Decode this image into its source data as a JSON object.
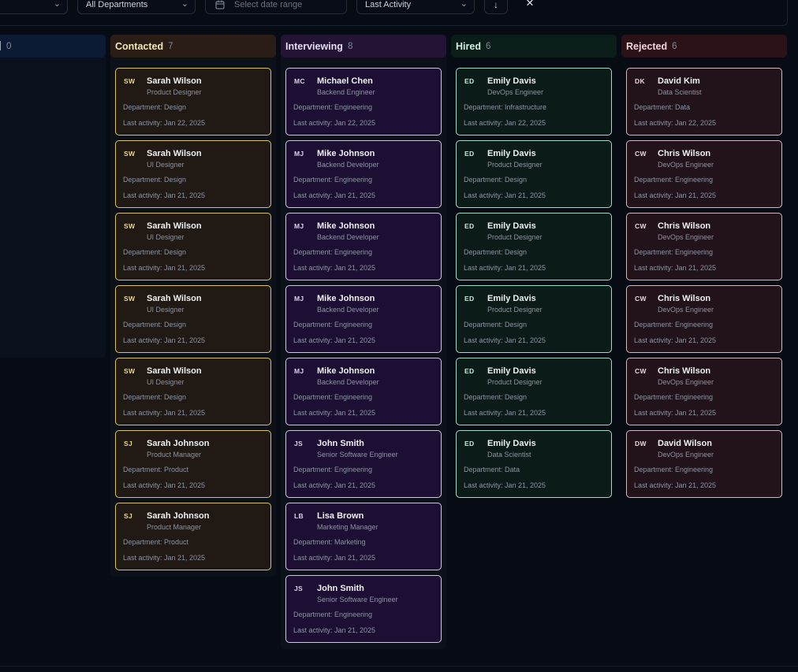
{
  "filters": {
    "department": "All Departments",
    "date_placeholder": "Select date range",
    "sort": "Last Activity"
  },
  "columns": [
    {
      "key": "new",
      "title": "",
      "count": "0",
      "color": "#0d1a33"
    },
    {
      "key": "contacted",
      "title": "Contacted",
      "count": "7",
      "color": "#2a1d15"
    },
    {
      "key": "interviewing",
      "title": "Interviewing",
      "count": "8",
      "color": "#231436"
    },
    {
      "key": "hired",
      "title": "Hired",
      "count": "6",
      "color": "#0b1d18"
    },
    {
      "key": "rejected",
      "title": "Rejected",
      "count": "6",
      "color": "#2a1216"
    }
  ],
  "contacted": [
    {
      "initials": "SW",
      "name": "Sarah Wilson",
      "role": "Product Designer",
      "dept": "Department: Design",
      "activity": "Last activity: Jan 22, 2025"
    },
    {
      "initials": "SW",
      "name": "Sarah Wilson",
      "role": "UI Designer",
      "dept": "Department: Design",
      "activity": "Last activity: Jan 21, 2025"
    },
    {
      "initials": "SW",
      "name": "Sarah Wilson",
      "role": "UI Designer",
      "dept": "Department: Design",
      "activity": "Last activity: Jan 21, 2025"
    },
    {
      "initials": "SW",
      "name": "Sarah Wilson",
      "role": "UI Designer",
      "dept": "Department: Design",
      "activity": "Last activity: Jan 21, 2025"
    },
    {
      "initials": "SW",
      "name": "Sarah Wilson",
      "role": "UI Designer",
      "dept": "Department: Design",
      "activity": "Last activity: Jan 21, 2025"
    },
    {
      "initials": "SJ",
      "name": "Sarah Johnson",
      "role": "Product Manager",
      "dept": "Department: Product",
      "activity": "Last activity: Jan 21, 2025"
    },
    {
      "initials": "SJ",
      "name": "Sarah Johnson",
      "role": "Product Manager",
      "dept": "Department: Product",
      "activity": "Last activity: Jan 21, 2025"
    }
  ],
  "interviewing": [
    {
      "initials": "MC",
      "name": "Michael Chen",
      "role": "Backend Engineer",
      "dept": "Department: Engineering",
      "activity": "Last activity: Jan 22, 2025"
    },
    {
      "initials": "MJ",
      "name": "Mike Johnson",
      "role": "Backend Developer",
      "dept": "Department: Engineering",
      "activity": "Last activity: Jan 21, 2025"
    },
    {
      "initials": "MJ",
      "name": "Mike Johnson",
      "role": "Backend Developer",
      "dept": "Department: Engineering",
      "activity": "Last activity: Jan 21, 2025"
    },
    {
      "initials": "MJ",
      "name": "Mike Johnson",
      "role": "Backend Developer",
      "dept": "Department: Engineering",
      "activity": "Last activity: Jan 21, 2025"
    },
    {
      "initials": "MJ",
      "name": "Mike Johnson",
      "role": "Backend Developer",
      "dept": "Department: Engineering",
      "activity": "Last activity: Jan 21, 2025"
    },
    {
      "initials": "JS",
      "name": "John Smith",
      "role": "Senior Software Engineer",
      "dept": "Department: Engineering",
      "activity": "Last activity: Jan 21, 2025"
    },
    {
      "initials": "LB",
      "name": "Lisa Brown",
      "role": "Marketing Manager",
      "dept": "Department: Marketing",
      "activity": "Last activity: Jan 21, 2025"
    },
    {
      "initials": "JS",
      "name": "John Smith",
      "role": "Senior Software Engineer",
      "dept": "Department: Engineering",
      "activity": "Last activity: Jan 21, 2025"
    }
  ],
  "hired": [
    {
      "initials": "ED",
      "name": "Emily Davis",
      "role": "DevOps Engineer",
      "dept": "Department: Infrastructure",
      "activity": "Last activity: Jan 22, 2025"
    },
    {
      "initials": "ED",
      "name": "Emily Davis",
      "role": "Product Designer",
      "dept": "Department: Design",
      "activity": "Last activity: Jan 21, 2025"
    },
    {
      "initials": "ED",
      "name": "Emily Davis",
      "role": "Product Designer",
      "dept": "Department: Design",
      "activity": "Last activity: Jan 21, 2025"
    },
    {
      "initials": "ED",
      "name": "Emily Davis",
      "role": "Product Designer",
      "dept": "Department: Design",
      "activity": "Last activity: Jan 21, 2025"
    },
    {
      "initials": "ED",
      "name": "Emily Davis",
      "role": "Product Designer",
      "dept": "Department: Design",
      "activity": "Last activity: Jan 21, 2025"
    },
    {
      "initials": "ED",
      "name": "Emily Davis",
      "role": "Data Scientist",
      "dept": "Department: Data",
      "activity": "Last activity: Jan 21, 2025"
    }
  ],
  "rejected": [
    {
      "initials": "DK",
      "name": "David Kim",
      "role": "Data Scientist",
      "dept": "Department: Data",
      "activity": "Last activity: Jan 22, 2025"
    },
    {
      "initials": "CW",
      "name": "Chris Wilson",
      "role": "DevOps Engineer",
      "dept": "Department: Engineering",
      "activity": "Last activity: Jan 21, 2025"
    },
    {
      "initials": "CW",
      "name": "Chris Wilson",
      "role": "DevOps Engineer",
      "dept": "Department: Engineering",
      "activity": "Last activity: Jan 21, 2025"
    },
    {
      "initials": "CW",
      "name": "Chris Wilson",
      "role": "DevOps Engineer",
      "dept": "Department: Engineering",
      "activity": "Last activity: Jan 21, 2025"
    },
    {
      "initials": "CW",
      "name": "Chris Wilson",
      "role": "DevOps Engineer",
      "dept": "Department: Engineering",
      "activity": "Last activity: Jan 21, 2025"
    },
    {
      "initials": "DW",
      "name": "David Wilson",
      "role": "DevOps Engineer",
      "dept": "Department: Engineering",
      "activity": "Last activity: Jan 21, 2025"
    }
  ]
}
